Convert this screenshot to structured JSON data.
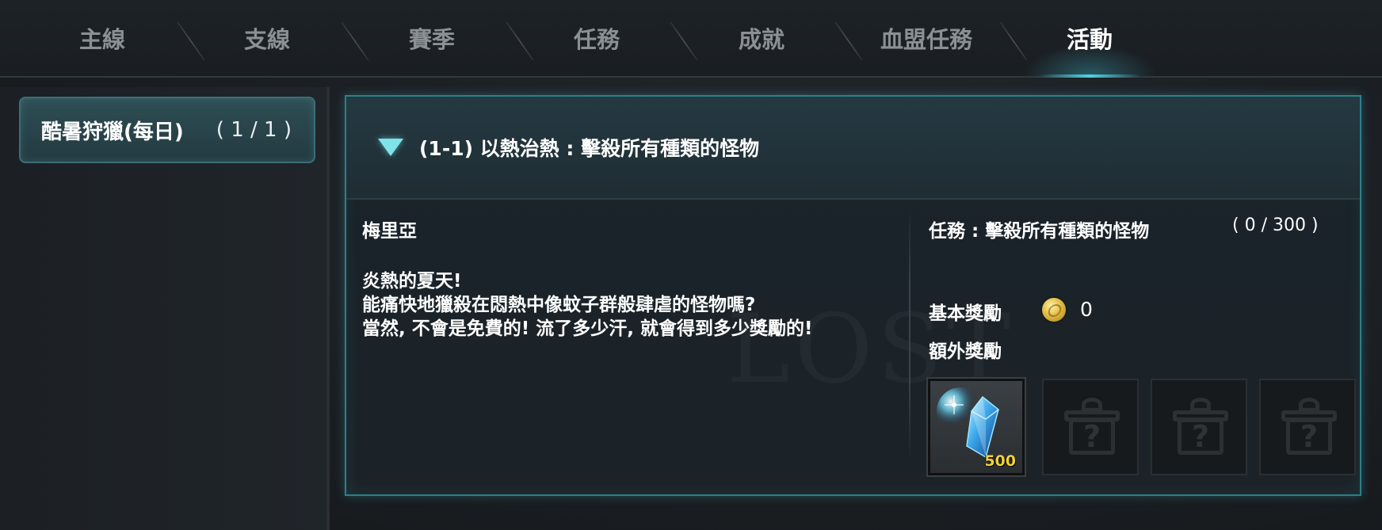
{
  "tabs": [
    {
      "label": "主線",
      "active": false
    },
    {
      "label": "支線",
      "active": false
    },
    {
      "label": "賽季",
      "active": false
    },
    {
      "label": "任務",
      "active": false
    },
    {
      "label": "成就",
      "active": false
    },
    {
      "label": "血盟任務",
      "active": false
    },
    {
      "label": "活動",
      "active": true
    }
  ],
  "sidebar": {
    "items": [
      {
        "label": "酷暑狩獵(每日)",
        "count": "( 1 / 1 )"
      }
    ]
  },
  "quest": {
    "title": "(1-1) 以熱治熱 : 擊殺所有種類的怪物",
    "npc": "梅里亞",
    "dialogue": [
      "炎熱的夏天!",
      "能痛快地獵殺在悶熱中像蚊子群般肆虐的怪物嗎?",
      "當然, 不會是免費的! 流了多少汗, 就會得到多少獎勵的!"
    ],
    "objective": "任務 : 擊殺所有種類的怪物",
    "objective_progress": "( 0 / 300 )",
    "base_reward_label": "基本獎勵",
    "base_reward_value": "0",
    "extra_reward_label": "額外獎勵",
    "reward_slots": [
      {
        "item": "blue-crystal-icon",
        "quantity": "500"
      },
      {
        "item": "mystery-gift-icon",
        "quantity": ""
      },
      {
        "item": "mystery-gift-icon",
        "quantity": ""
      },
      {
        "item": "mystery-gift-icon",
        "quantity": ""
      }
    ]
  },
  "colors": {
    "accent": "#4fd3e3",
    "quantity": "#f2d23a"
  }
}
